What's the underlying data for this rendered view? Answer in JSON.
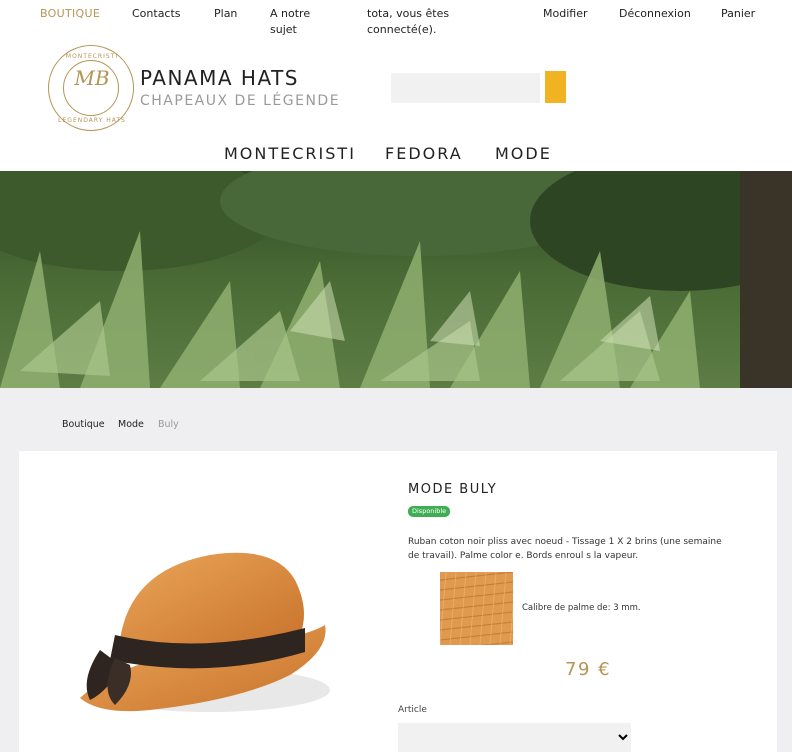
{
  "topnav": {
    "boutique": "BOUTIQUE",
    "contacts": "Contacts",
    "plan": "Plan",
    "about_line1": "A notre",
    "about_line2": "sujet",
    "greeting_line1": "tota, vous êtes",
    "greeting_line2": "connecté(e).",
    "modifier": "Modifier",
    "deconnexion": "Déconnexion",
    "panier": "Panier"
  },
  "header": {
    "logo_text_top": "MONTECRISTI",
    "logo_text_bottom": "LEGENDARY HATS",
    "logo_monogram": "MB",
    "title": "PANAMA HATS",
    "subtitle": "CHAPEAUX DE LÉGENDE",
    "search_placeholder": ""
  },
  "mainnav": [
    "MONTECRISTI",
    "FEDORA",
    "MODE"
  ],
  "breadcrumb": [
    "Boutique",
    "Mode",
    "Buly"
  ],
  "product": {
    "title": "MODE BULY",
    "badge": "Disponible",
    "description_line1": "Ruban coton noir pliss   avec noeud - Tissage 1 X 2 brins (une semaine",
    "description_line2": "de travail). Palme color  e. Bords enroul  s    la vapeur.",
    "calibre": "Calibre de palme de: 3 mm.",
    "price": "79 €",
    "article_label": "Article"
  },
  "colors": {
    "accent_gold": "#b69455",
    "search_button": "#f2b323",
    "badge_green": "#3fae52",
    "gray_background": "#efeff1"
  }
}
